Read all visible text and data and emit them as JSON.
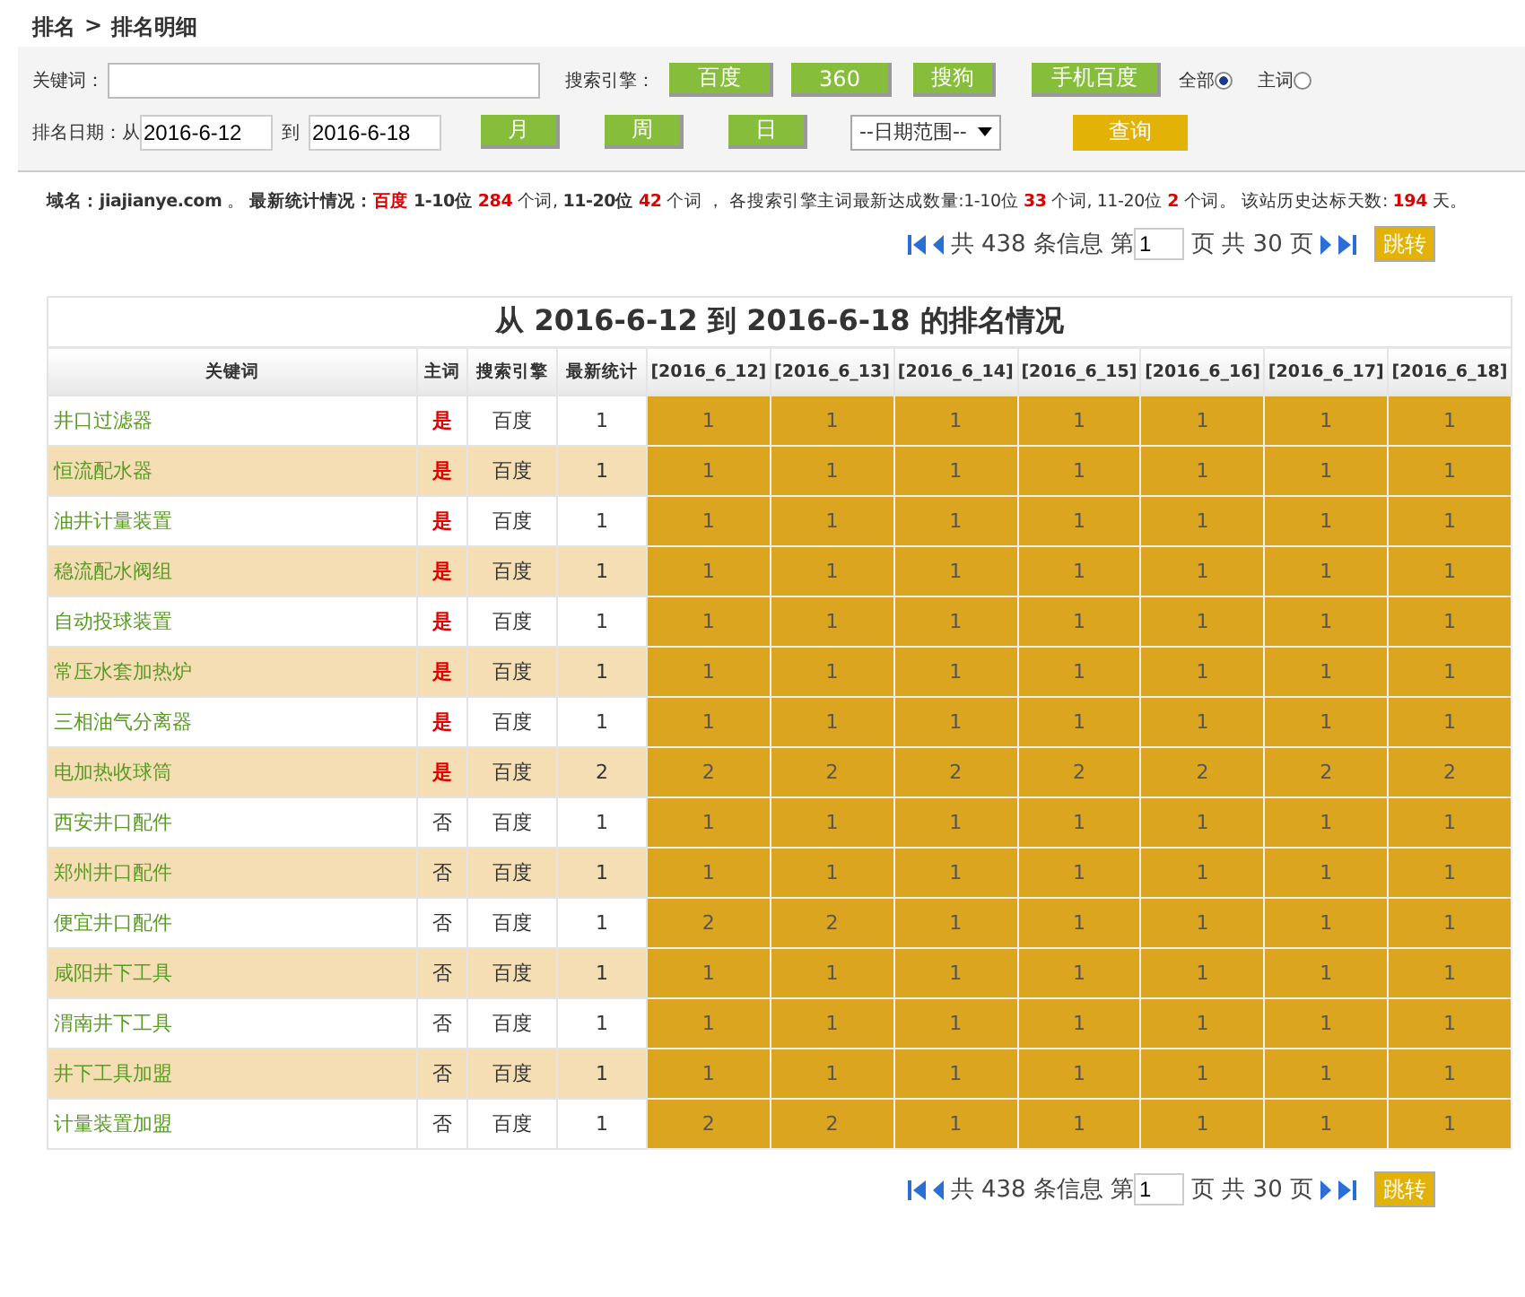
{
  "breadcrumb": {
    "parent": "排名",
    "separator": ">",
    "current": "排名明细"
  },
  "filter": {
    "keyword_label": "关键词：",
    "engine_label": "搜索引擎：",
    "engine_buttons": [
      "百度",
      "360",
      "搜狗",
      "手机百度"
    ],
    "scope_options": [
      {
        "label": "全部",
        "selected": true
      },
      {
        "label": "主词",
        "selected": false
      }
    ],
    "date_label": "排名日期：从",
    "date_from": "2016-6-12",
    "date_to_label": "到",
    "date_to": "2016-6-18",
    "period_buttons": [
      "月",
      "周",
      "日"
    ],
    "range_select": "--日期范围--",
    "query_button": "查询"
  },
  "summary": [
    {
      "text": "域名：jiajianye.com",
      "red": false,
      "bold": true
    },
    {
      "text": " 。 ",
      "red": false,
      "bold": false
    },
    {
      "text": "最新统计情况：",
      "red": false,
      "bold": true
    },
    {
      "text": "百度",
      "red": true,
      "bold": true
    },
    {
      "text": " 1-10位 ",
      "red": false,
      "bold": true
    },
    {
      "text": "284",
      "red": true,
      "bold": true
    },
    {
      "text": " 个词, ",
      "red": false,
      "bold": false
    },
    {
      "text": "11-20位 ",
      "red": false,
      "bold": true
    },
    {
      "text": "42",
      "red": true,
      "bold": true
    },
    {
      "text": " 个词 ， 各搜索引擎主词最新达成数量:1-10位 ",
      "red": false,
      "bold": false
    },
    {
      "text": "33",
      "red": true,
      "bold": true
    },
    {
      "text": " 个词, 11-20位 ",
      "red": false,
      "bold": false
    },
    {
      "text": "2",
      "red": true,
      "bold": true
    },
    {
      "text": " 个词。 该站历史达标天数: ",
      "red": false,
      "bold": false
    },
    {
      "text": "194",
      "red": true,
      "bold": true
    },
    {
      "text": " 天。",
      "red": false,
      "bold": false
    }
  ],
  "pagination_top": {
    "total": "共 438 条信息 第",
    "page": "1",
    "pages": "页 共 30 页",
    "go_button": "跳转"
  },
  "table": {
    "title": "从 2016-6-12 到 2016-6-18 的排名情况",
    "columns": [
      "关键词",
      "主词",
      "搜索引擎",
      "最新统计",
      "[2016_6_12]",
      "[2016_6_13]",
      "[2016_6_14]",
      "[2016_6_15]",
      "[2016_6_16]",
      "[2016_6_17]",
      "[2016_6_18]"
    ],
    "rows": [
      {
        "keyword": "井口过滤器",
        "main_word": "是",
        "main": true,
        "engine": "百度",
        "latest": "1",
        "ranks": [
          "1",
          "1",
          "1",
          "1",
          "1",
          "1",
          "1"
        ]
      },
      {
        "keyword": "恒流配水器",
        "main_word": "是",
        "main": true,
        "engine": "百度",
        "latest": "1",
        "ranks": [
          "1",
          "1",
          "1",
          "1",
          "1",
          "1",
          "1"
        ]
      },
      {
        "keyword": "油井计量装置",
        "main_word": "是",
        "main": true,
        "engine": "百度",
        "latest": "1",
        "ranks": [
          "1",
          "1",
          "1",
          "1",
          "1",
          "1",
          "1"
        ]
      },
      {
        "keyword": "稳流配水阀组",
        "main_word": "是",
        "main": true,
        "engine": "百度",
        "latest": "1",
        "ranks": [
          "1",
          "1",
          "1",
          "1",
          "1",
          "1",
          "1"
        ]
      },
      {
        "keyword": "自动投球装置",
        "main_word": "是",
        "main": true,
        "engine": "百度",
        "latest": "1",
        "ranks": [
          "1",
          "1",
          "1",
          "1",
          "1",
          "1",
          "1"
        ]
      },
      {
        "keyword": "常压水套加热炉",
        "main_word": "是",
        "main": true,
        "engine": "百度",
        "latest": "1",
        "ranks": [
          "1",
          "1",
          "1",
          "1",
          "1",
          "1",
          "1"
        ]
      },
      {
        "keyword": "三相油气分离器",
        "main_word": "是",
        "main": true,
        "engine": "百度",
        "latest": "1",
        "ranks": [
          "1",
          "1",
          "1",
          "1",
          "1",
          "1",
          "1"
        ]
      },
      {
        "keyword": "电加热收球筒",
        "main_word": "是",
        "main": true,
        "engine": "百度",
        "latest": "2",
        "ranks": [
          "2",
          "2",
          "2",
          "2",
          "2",
          "2",
          "2"
        ]
      },
      {
        "keyword": "西安井口配件",
        "main_word": "否",
        "main": false,
        "engine": "百度",
        "latest": "1",
        "ranks": [
          "1",
          "1",
          "1",
          "1",
          "1",
          "1",
          "1"
        ]
      },
      {
        "keyword": "郑州井口配件",
        "main_word": "否",
        "main": false,
        "engine": "百度",
        "latest": "1",
        "ranks": [
          "1",
          "1",
          "1",
          "1",
          "1",
          "1",
          "1"
        ]
      },
      {
        "keyword": "便宜井口配件",
        "main_word": "否",
        "main": false,
        "engine": "百度",
        "latest": "1",
        "ranks": [
          "2",
          "2",
          "1",
          "1",
          "1",
          "1",
          "1"
        ]
      },
      {
        "keyword": "咸阳井下工具",
        "main_word": "否",
        "main": false,
        "engine": "百度",
        "latest": "1",
        "ranks": [
          "1",
          "1",
          "1",
          "1",
          "1",
          "1",
          "1"
        ]
      },
      {
        "keyword": "渭南井下工具",
        "main_word": "否",
        "main": false,
        "engine": "百度",
        "latest": "1",
        "ranks": [
          "1",
          "1",
          "1",
          "1",
          "1",
          "1",
          "1"
        ]
      },
      {
        "keyword": "井下工具加盟",
        "main_word": "否",
        "main": false,
        "engine": "百度",
        "latest": "1",
        "ranks": [
          "1",
          "1",
          "1",
          "1",
          "1",
          "1",
          "1"
        ]
      },
      {
        "keyword": "计量装置加盟",
        "main_word": "否",
        "main": false,
        "engine": "百度",
        "latest": "1",
        "ranks": [
          "2",
          "2",
          "1",
          "1",
          "1",
          "1",
          "1"
        ]
      }
    ]
  },
  "pagination_bottom": {
    "total": "共 438 条信息 第",
    "page": "1",
    "pages": "页 共 30 页",
    "go_button": "跳转"
  }
}
